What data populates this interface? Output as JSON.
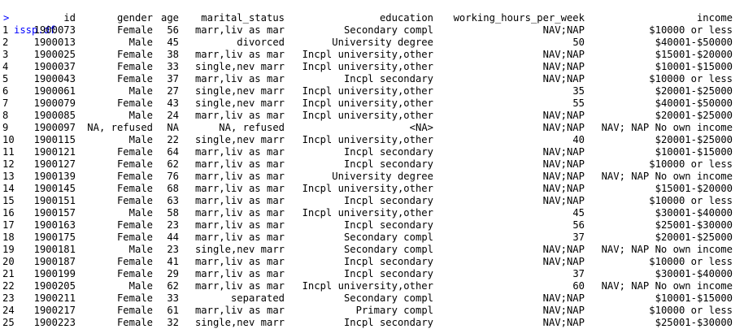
{
  "console": {
    "prompt": ">",
    "command": "issp.df",
    "headers": {
      "id": "id",
      "gender": "gender",
      "age": "age",
      "marital_status": "marital_status",
      "education": "education",
      "working_hours_per_week": "working_hours_per_week",
      "income": "income"
    },
    "rows": [
      {
        "idx": "1",
        "id": "1900073",
        "gender": "Female",
        "age": "56",
        "marital": "marr,liv as mar",
        "edu": "Secondary compl",
        "hours": "NAV;NAP",
        "income": "$10000 or less"
      },
      {
        "idx": "2",
        "id": "1900013",
        "gender": "Male",
        "age": "45",
        "marital": "divorced",
        "edu": "University degree",
        "hours": "50",
        "income": "$40001-$50000"
      },
      {
        "idx": "3",
        "id": "1900025",
        "gender": "Female",
        "age": "38",
        "marital": "marr,liv as mar",
        "edu": "Incpl university,other",
        "hours": "NAV;NAP",
        "income": "$15001-$20000"
      },
      {
        "idx": "4",
        "id": "1900037",
        "gender": "Female",
        "age": "33",
        "marital": "single,nev marr",
        "edu": "Incpl university,other",
        "hours": "NAV;NAP",
        "income": "$10001-$15000"
      },
      {
        "idx": "5",
        "id": "1900043",
        "gender": "Female",
        "age": "37",
        "marital": "marr,liv as mar",
        "edu": "Incpl secondary",
        "hours": "NAV;NAP",
        "income": "$10000 or less"
      },
      {
        "idx": "6",
        "id": "1900061",
        "gender": "Male",
        "age": "27",
        "marital": "single,nev marr",
        "edu": "Incpl university,other",
        "hours": "35",
        "income": "$20001-$25000"
      },
      {
        "idx": "7",
        "id": "1900079",
        "gender": "Female",
        "age": "43",
        "marital": "single,nev marr",
        "edu": "Incpl university,other",
        "hours": "55",
        "income": "$40001-$50000"
      },
      {
        "idx": "8",
        "id": "1900085",
        "gender": "Male",
        "age": "24",
        "marital": "marr,liv as mar",
        "edu": "Incpl university,other",
        "hours": "NAV;NAP",
        "income": "$20001-$25000"
      },
      {
        "idx": "9",
        "id": "1900097",
        "gender": "NA, refused",
        "age": "NA",
        "marital": "NA, refused",
        "edu": "<NA>",
        "hours": "NAV;NAP",
        "income": "NAV; NAP No own income"
      },
      {
        "idx": "10",
        "id": "1900115",
        "gender": "Male",
        "age": "22",
        "marital": "single,nev marr",
        "edu": "Incpl university,other",
        "hours": "40",
        "income": "$20001-$25000"
      },
      {
        "idx": "11",
        "id": "1900121",
        "gender": "Female",
        "age": "64",
        "marital": "marr,liv as mar",
        "edu": "Incpl secondary",
        "hours": "NAV;NAP",
        "income": "$10001-$15000"
      },
      {
        "idx": "12",
        "id": "1900127",
        "gender": "Female",
        "age": "62",
        "marital": "marr,liv as mar",
        "edu": "Incpl secondary",
        "hours": "NAV;NAP",
        "income": "$10000 or less"
      },
      {
        "idx": "13",
        "id": "1900139",
        "gender": "Female",
        "age": "76",
        "marital": "marr,liv as mar",
        "edu": "University degree",
        "hours": "NAV;NAP",
        "income": "NAV; NAP No own income"
      },
      {
        "idx": "14",
        "id": "1900145",
        "gender": "Female",
        "age": "68",
        "marital": "marr,liv as mar",
        "edu": "Incpl university,other",
        "hours": "NAV;NAP",
        "income": "$15001-$20000"
      },
      {
        "idx": "15",
        "id": "1900151",
        "gender": "Female",
        "age": "63",
        "marital": "marr,liv as mar",
        "edu": "Incpl secondary",
        "hours": "NAV;NAP",
        "income": "$10000 or less"
      },
      {
        "idx": "16",
        "id": "1900157",
        "gender": "Male",
        "age": "58",
        "marital": "marr,liv as mar",
        "edu": "Incpl university,other",
        "hours": "45",
        "income": "$30001-$40000"
      },
      {
        "idx": "17",
        "id": "1900163",
        "gender": "Female",
        "age": "23",
        "marital": "marr,liv as mar",
        "edu": "Incpl secondary",
        "hours": "56",
        "income": "$25001-$30000"
      },
      {
        "idx": "18",
        "id": "1900175",
        "gender": "Female",
        "age": "44",
        "marital": "marr,liv as mar",
        "edu": "Secondary compl",
        "hours": "37",
        "income": "$20001-$25000"
      },
      {
        "idx": "19",
        "id": "1900181",
        "gender": "Male",
        "age": "23",
        "marital": "single,nev marr",
        "edu": "Secondary compl",
        "hours": "NAV;NAP",
        "income": "NAV; NAP No own income"
      },
      {
        "idx": "20",
        "id": "1900187",
        "gender": "Female",
        "age": "41",
        "marital": "marr,liv as mar",
        "edu": "Incpl secondary",
        "hours": "NAV;NAP",
        "income": "$10000 or less"
      },
      {
        "idx": "21",
        "id": "1900199",
        "gender": "Female",
        "age": "29",
        "marital": "marr,liv as mar",
        "edu": "Incpl secondary",
        "hours": "37",
        "income": "$30001-$40000"
      },
      {
        "idx": "22",
        "id": "1900205",
        "gender": "Male",
        "age": "62",
        "marital": "marr,liv as mar",
        "edu": "Incpl university,other",
        "hours": "60",
        "income": "NAV; NAP No own income"
      },
      {
        "idx": "23",
        "id": "1900211",
        "gender": "Female",
        "age": "33",
        "marital": "separated",
        "edu": "Secondary compl",
        "hours": "NAV;NAP",
        "income": "$10001-$15000"
      },
      {
        "idx": "24",
        "id": "1900217",
        "gender": "Female",
        "age": "61",
        "marital": "marr,liv as mar",
        "edu": "Primary compl",
        "hours": "NAV;NAP",
        "income": "$10000 or less"
      },
      {
        "idx": "25",
        "id": "1900223",
        "gender": "Female",
        "age": "32",
        "marital": "single,nev marr",
        "edu": "Incpl secondary",
        "hours": "NAV;NAP",
        "income": "$25001-$30000"
      }
    ]
  }
}
